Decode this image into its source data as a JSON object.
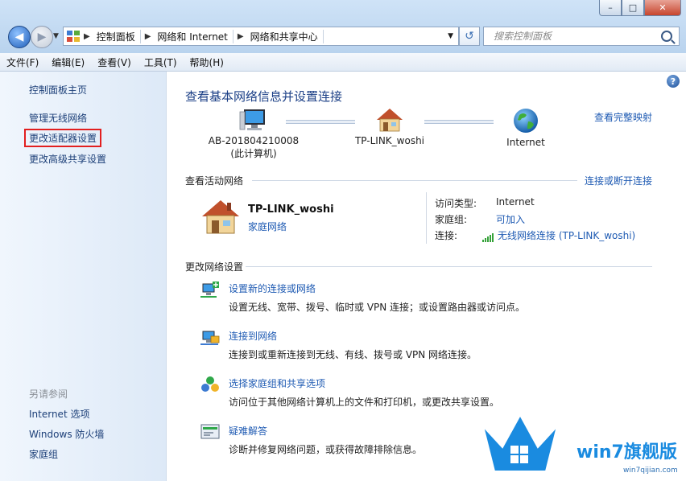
{
  "window": {
    "min": "–",
    "max": "□",
    "close": "✕"
  },
  "address": {
    "crumbs": [
      "控制面板",
      "网络和 Internet",
      "网络和共享中心"
    ]
  },
  "search": {
    "placeholder": "搜索控制面板"
  },
  "menu": [
    "文件(F)",
    "编辑(E)",
    "查看(V)",
    "工具(T)",
    "帮助(H)"
  ],
  "sidebar": {
    "items": [
      "控制面板主页",
      "管理无线网络",
      "更改适配器设置",
      "更改高级共享设置"
    ],
    "see_also_title": "另请参阅",
    "see_also": [
      "Internet 选项",
      "Windows 防火墙",
      "家庭组"
    ]
  },
  "main": {
    "heading": "查看基本网络信息并设置连接",
    "full_map": "查看完整映射",
    "nodes": [
      {
        "line1": "AB-201804210008",
        "line2": "(此计算机)"
      },
      {
        "line1": "TP-LINK_woshi",
        "line2": ""
      },
      {
        "line1": "Internet",
        "line2": ""
      }
    ],
    "active_title": "查看活动网络",
    "connect_disconnect": "连接或断开连接",
    "network_name": "TP-LINK_woshi",
    "network_type": "家庭网络",
    "props": [
      {
        "label": "访问类型:",
        "value": "Internet",
        "link": false
      },
      {
        "label": "家庭组:",
        "value": "可加入",
        "link": true
      },
      {
        "label": "连接:",
        "value": "无线网络连接 (TP-LINK_woshi)",
        "link": true
      }
    ],
    "change_title": "更改网络设置",
    "tasks": [
      {
        "title": "设置新的连接或网络",
        "desc": "设置无线、宽带、拨号、临时或 VPN 连接；或设置路由器或访问点。"
      },
      {
        "title": "连接到网络",
        "desc": "连接到或重新连接到无线、有线、拨号或 VPN 网络连接。"
      },
      {
        "title": "选择家庭组和共享选项",
        "desc": "访问位于其他网络计算机上的文件和打印机，或更改共享设置。"
      },
      {
        "title": "疑难解答",
        "desc": "诊断并修复网络问题，或获得故障排除信息。"
      }
    ]
  },
  "watermark": {
    "text": "win7旗舰版",
    "url": "win7qijian.com"
  }
}
